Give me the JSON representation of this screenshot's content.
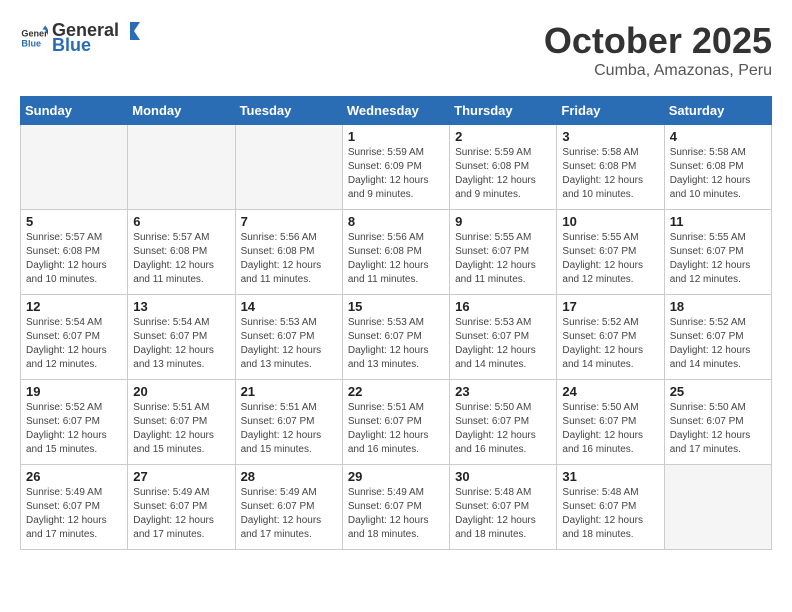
{
  "header": {
    "logo_general": "General",
    "logo_blue": "Blue",
    "month": "October 2025",
    "location": "Cumba, Amazonas, Peru"
  },
  "days_of_week": [
    "Sunday",
    "Monday",
    "Tuesday",
    "Wednesday",
    "Thursday",
    "Friday",
    "Saturday"
  ],
  "weeks": [
    [
      {
        "day": "",
        "info": ""
      },
      {
        "day": "",
        "info": ""
      },
      {
        "day": "",
        "info": ""
      },
      {
        "day": "1",
        "info": "Sunrise: 5:59 AM\nSunset: 6:09 PM\nDaylight: 12 hours and 9 minutes."
      },
      {
        "day": "2",
        "info": "Sunrise: 5:59 AM\nSunset: 6:08 PM\nDaylight: 12 hours and 9 minutes."
      },
      {
        "day": "3",
        "info": "Sunrise: 5:58 AM\nSunset: 6:08 PM\nDaylight: 12 hours and 10 minutes."
      },
      {
        "day": "4",
        "info": "Sunrise: 5:58 AM\nSunset: 6:08 PM\nDaylight: 12 hours and 10 minutes."
      }
    ],
    [
      {
        "day": "5",
        "info": "Sunrise: 5:57 AM\nSunset: 6:08 PM\nDaylight: 12 hours and 10 minutes."
      },
      {
        "day": "6",
        "info": "Sunrise: 5:57 AM\nSunset: 6:08 PM\nDaylight: 12 hours and 11 minutes."
      },
      {
        "day": "7",
        "info": "Sunrise: 5:56 AM\nSunset: 6:08 PM\nDaylight: 12 hours and 11 minutes."
      },
      {
        "day": "8",
        "info": "Sunrise: 5:56 AM\nSunset: 6:08 PM\nDaylight: 12 hours and 11 minutes."
      },
      {
        "day": "9",
        "info": "Sunrise: 5:55 AM\nSunset: 6:07 PM\nDaylight: 12 hours and 11 minutes."
      },
      {
        "day": "10",
        "info": "Sunrise: 5:55 AM\nSunset: 6:07 PM\nDaylight: 12 hours and 12 minutes."
      },
      {
        "day": "11",
        "info": "Sunrise: 5:55 AM\nSunset: 6:07 PM\nDaylight: 12 hours and 12 minutes."
      }
    ],
    [
      {
        "day": "12",
        "info": "Sunrise: 5:54 AM\nSunset: 6:07 PM\nDaylight: 12 hours and 12 minutes."
      },
      {
        "day": "13",
        "info": "Sunrise: 5:54 AM\nSunset: 6:07 PM\nDaylight: 12 hours and 13 minutes."
      },
      {
        "day": "14",
        "info": "Sunrise: 5:53 AM\nSunset: 6:07 PM\nDaylight: 12 hours and 13 minutes."
      },
      {
        "day": "15",
        "info": "Sunrise: 5:53 AM\nSunset: 6:07 PM\nDaylight: 12 hours and 13 minutes."
      },
      {
        "day": "16",
        "info": "Sunrise: 5:53 AM\nSunset: 6:07 PM\nDaylight: 12 hours and 14 minutes."
      },
      {
        "day": "17",
        "info": "Sunrise: 5:52 AM\nSunset: 6:07 PM\nDaylight: 12 hours and 14 minutes."
      },
      {
        "day": "18",
        "info": "Sunrise: 5:52 AM\nSunset: 6:07 PM\nDaylight: 12 hours and 14 minutes."
      }
    ],
    [
      {
        "day": "19",
        "info": "Sunrise: 5:52 AM\nSunset: 6:07 PM\nDaylight: 12 hours and 15 minutes."
      },
      {
        "day": "20",
        "info": "Sunrise: 5:51 AM\nSunset: 6:07 PM\nDaylight: 12 hours and 15 minutes."
      },
      {
        "day": "21",
        "info": "Sunrise: 5:51 AM\nSunset: 6:07 PM\nDaylight: 12 hours and 15 minutes."
      },
      {
        "day": "22",
        "info": "Sunrise: 5:51 AM\nSunset: 6:07 PM\nDaylight: 12 hours and 16 minutes."
      },
      {
        "day": "23",
        "info": "Sunrise: 5:50 AM\nSunset: 6:07 PM\nDaylight: 12 hours and 16 minutes."
      },
      {
        "day": "24",
        "info": "Sunrise: 5:50 AM\nSunset: 6:07 PM\nDaylight: 12 hours and 16 minutes."
      },
      {
        "day": "25",
        "info": "Sunrise: 5:50 AM\nSunset: 6:07 PM\nDaylight: 12 hours and 17 minutes."
      }
    ],
    [
      {
        "day": "26",
        "info": "Sunrise: 5:49 AM\nSunset: 6:07 PM\nDaylight: 12 hours and 17 minutes."
      },
      {
        "day": "27",
        "info": "Sunrise: 5:49 AM\nSunset: 6:07 PM\nDaylight: 12 hours and 17 minutes."
      },
      {
        "day": "28",
        "info": "Sunrise: 5:49 AM\nSunset: 6:07 PM\nDaylight: 12 hours and 17 minutes."
      },
      {
        "day": "29",
        "info": "Sunrise: 5:49 AM\nSunset: 6:07 PM\nDaylight: 12 hours and 18 minutes."
      },
      {
        "day": "30",
        "info": "Sunrise: 5:48 AM\nSunset: 6:07 PM\nDaylight: 12 hours and 18 minutes."
      },
      {
        "day": "31",
        "info": "Sunrise: 5:48 AM\nSunset: 6:07 PM\nDaylight: 12 hours and 18 minutes."
      },
      {
        "day": "",
        "info": ""
      }
    ]
  ]
}
